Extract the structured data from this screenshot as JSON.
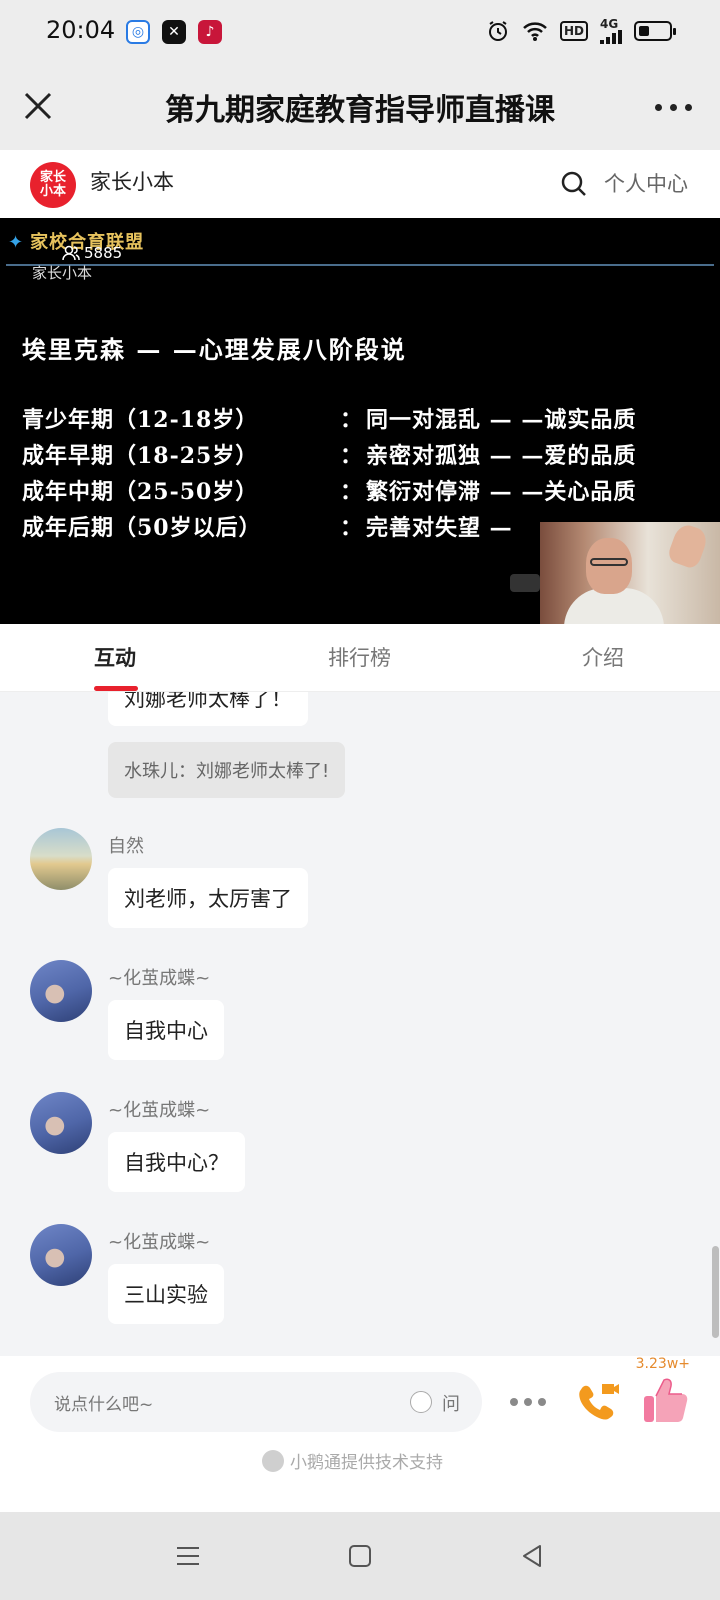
{
  "status_bar": {
    "time": "20:04",
    "network": "4G",
    "hd": "HD",
    "app_icons": [
      "browser-icon",
      "capcut-icon",
      "tiktok-icon"
    ],
    "right_icons": [
      "alarm-icon",
      "wifi-icon",
      "hd-icon",
      "signal-icon",
      "battery-icon"
    ]
  },
  "titlebar": {
    "title": "第九期家庭教育指导师直播课"
  },
  "channel": {
    "logo_text": "家长小本",
    "name": "家长小本",
    "profile_label": "个人中心"
  },
  "video": {
    "watermark": "家校合育联盟",
    "viewer_count": "5885",
    "sub_label": "家长小本",
    "slide_heading": "埃里克森 — —心理发展八阶段说",
    "slide_rows": [
      {
        "stage": "青少年期（12-18岁）",
        "sep": "：",
        "desc": "同一对混乱 — —诚实品质"
      },
      {
        "stage": "成年早期（18-25岁）",
        "sep": "：",
        "desc": "亲密对孤独 — —爱的品质"
      },
      {
        "stage": "成年中期（25-50岁）",
        "sep": "：",
        "desc": "繁衍对停滞 — —关心品质"
      },
      {
        "stage": "成年后期（50岁以后）",
        "sep": "：",
        "desc": "完善对失望 —"
      }
    ]
  },
  "tabs": [
    {
      "label": "互动",
      "active": true
    },
    {
      "label": "排行榜",
      "active": false
    },
    {
      "label": "介绍",
      "active": false
    }
  ],
  "chat": {
    "partial_bubble": "刘娜老师太棒了！",
    "quote_bubble": "水珠儿：刘娜老师太棒了!",
    "messages": [
      {
        "user": "自然",
        "text": "刘老师，太厉害了",
        "avatar": "sunset-avatar"
      },
      {
        "user": "~化茧成蝶~",
        "text": "自我中心",
        "avatar": "hand-avatar"
      },
      {
        "user": "~化茧成蝶~",
        "text": "自我中心？",
        "avatar": "hand-avatar"
      },
      {
        "user": "~化茧成蝶~",
        "text": "三山实验",
        "avatar": "hand-avatar"
      }
    ]
  },
  "input": {
    "placeholder": "说点什么吧~",
    "ask_label": "问",
    "like_count": "3.23w+",
    "powered_by": "小鹅通提供技术支持"
  },
  "colors": {
    "accent": "#e8212d",
    "like_count": "#e58a2d",
    "phone_icon": "#f39a1e"
  }
}
